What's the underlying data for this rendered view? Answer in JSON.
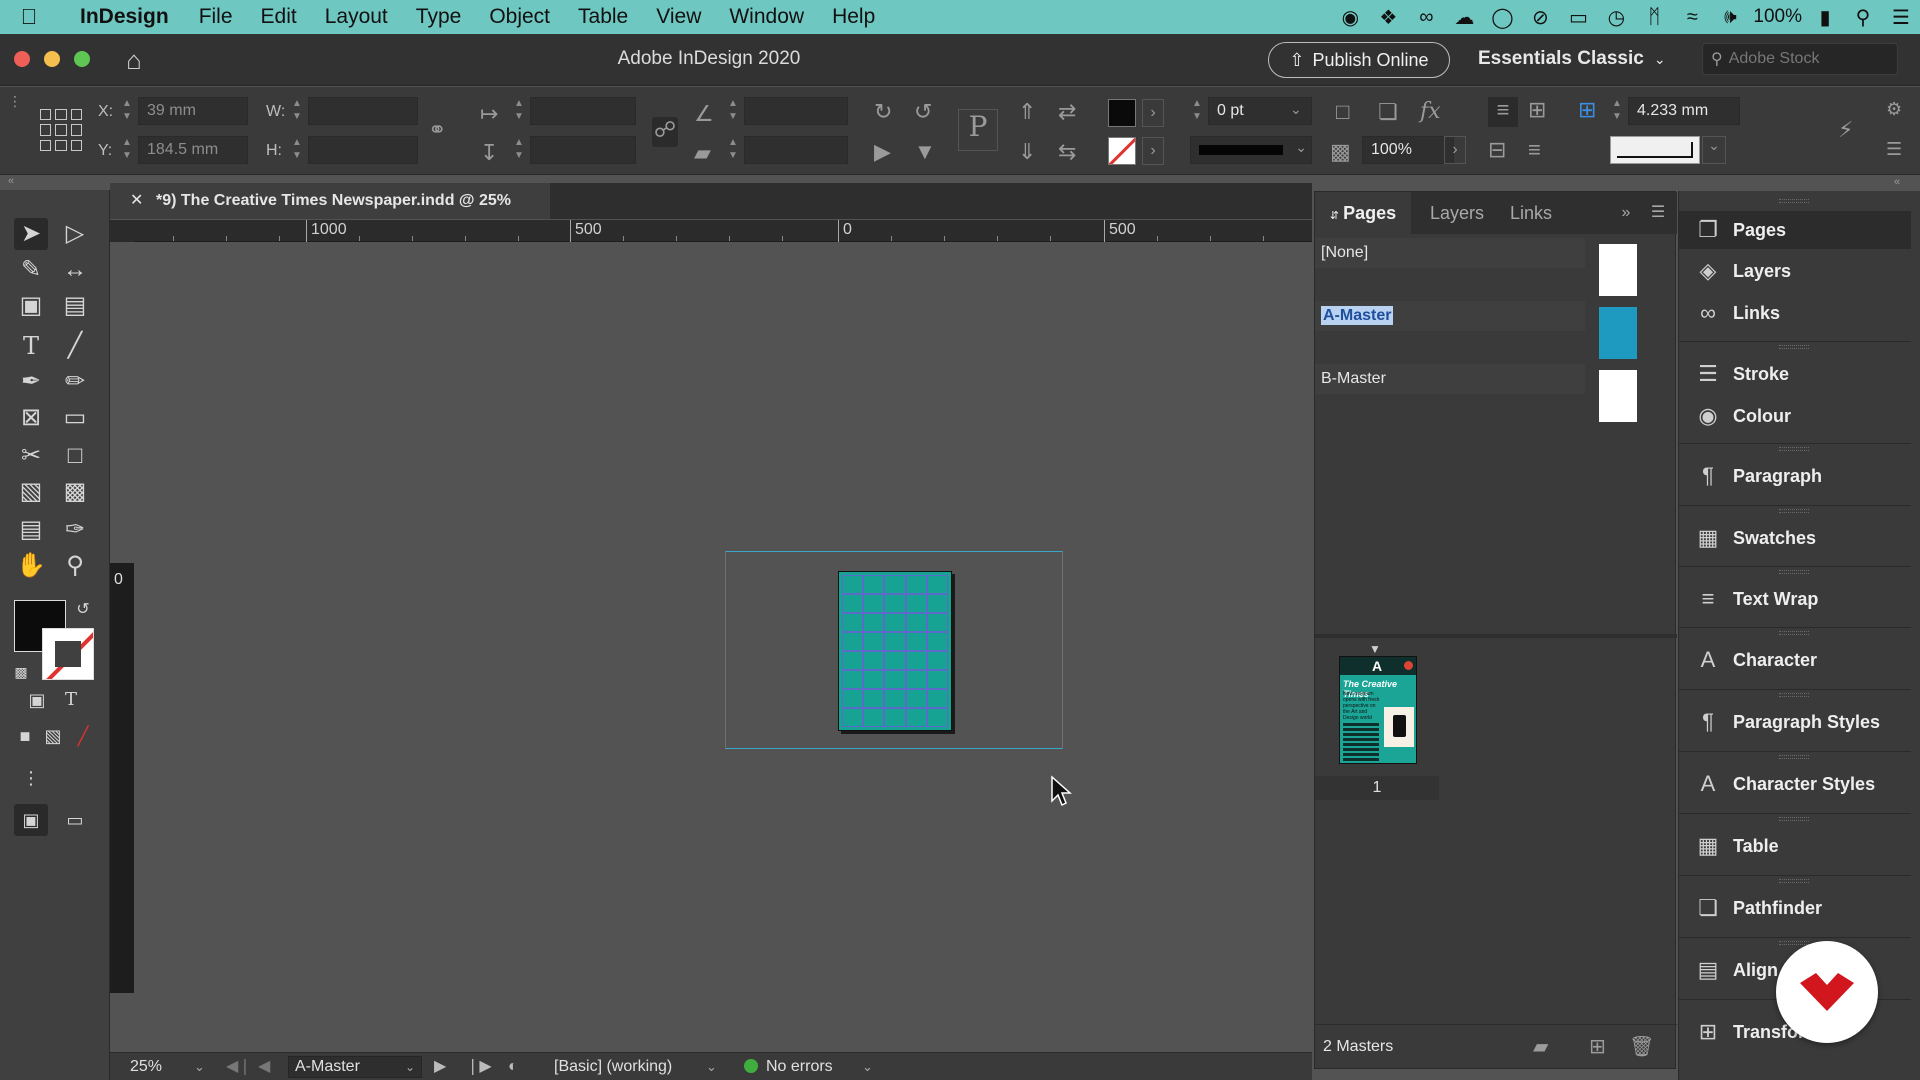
{
  "menubar": {
    "app_name": "InDesign",
    "items": [
      "File",
      "Edit",
      "Layout",
      "Type",
      "Object",
      "Table",
      "View",
      "Window",
      "Help"
    ],
    "battery": "100%"
  },
  "titlebar": {
    "title": "Adobe InDesign 2020",
    "publish_label": "Publish Online",
    "workspace": "Essentials Classic",
    "stock_placeholder": "Adobe Stock"
  },
  "control": {
    "x_label": "X:",
    "x_value": "39 mm",
    "y_label": "Y:",
    "y_value": "184.5 mm",
    "w_label": "W:",
    "h_label": "H:",
    "stroke_weight": "0 pt",
    "opacity": "100%",
    "gap": "4.233 mm"
  },
  "document": {
    "tab_title": "*9) The Creative Times Newspaper.indd @ 25%"
  },
  "ruler": {
    "labels": [
      "1000",
      "500",
      "0",
      "500"
    ],
    "v_zero": "0"
  },
  "status": {
    "zoom": "25%",
    "page": "A-Master",
    "profile": "[Basic] (working)",
    "preflight": "No errors"
  },
  "pages_panel": {
    "tabs": [
      "Pages",
      "Layers",
      "Links"
    ],
    "masters": [
      "[None]",
      "A-Master",
      "B-Master"
    ],
    "thumb_title": "The Creative Times",
    "thumb_headline": "New museum opens with fresh perspective on the Art and Design world",
    "page_number": "1",
    "footer": "2 Masters"
  },
  "dock": {
    "items": [
      "Pages",
      "Layers",
      "Links",
      "Stroke",
      "Colour",
      "Paragraph",
      "Swatches",
      "Text Wrap",
      "Character",
      "Paragraph Styles",
      "Character Styles",
      "Table",
      "Pathfinder",
      "Align",
      "Transform"
    ]
  },
  "colors": {
    "menubar": "#6fc7c1",
    "page_fill": "#17a394",
    "master_a": "#1e9ac1",
    "selection_guide": "#3aa7c9",
    "badge_red": "#d1161d"
  }
}
